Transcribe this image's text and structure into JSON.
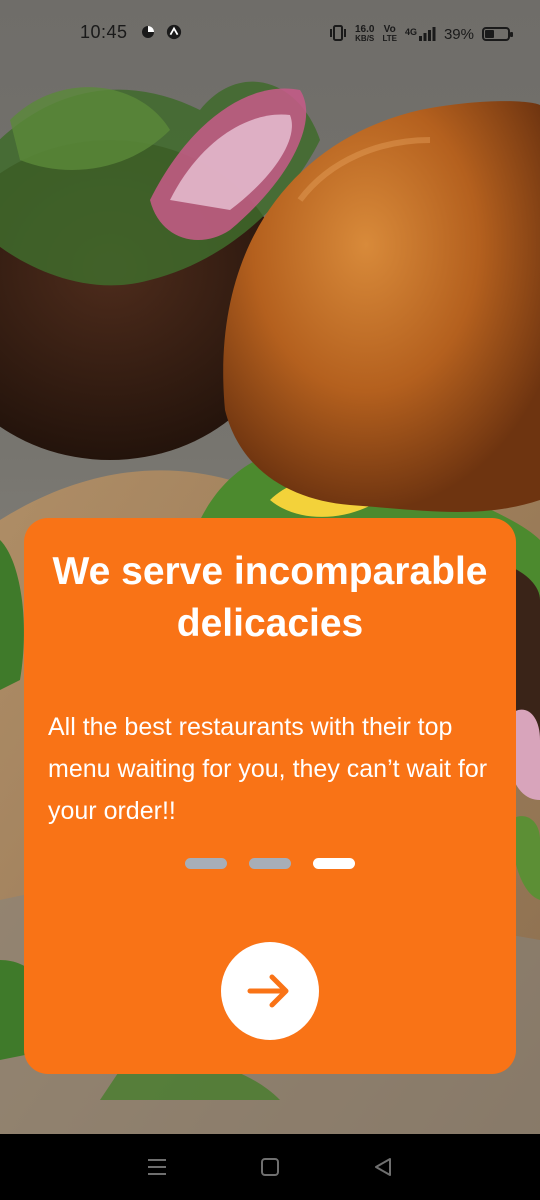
{
  "status_bar": {
    "time": "10:45",
    "network_speed": "16.0",
    "network_unit": "KB/S",
    "volte": "Vo",
    "lte": "LTE",
    "signal": "4G",
    "battery_percent": "39%",
    "battery_level": 0.39,
    "icons": [
      "app-icon",
      "arrow-badge-icon",
      "vibrate-icon",
      "signal-icon",
      "battery-icon"
    ]
  },
  "onboarding": {
    "title": "We serve incomparable delicacies",
    "description": "All the best restaurants with their top menu waiting for you, they can’t wait for your order!!",
    "pages": [
      {
        "active": false
      },
      {
        "active": false
      },
      {
        "active": true
      }
    ],
    "next_icon": "arrow-right-icon"
  },
  "nav_bar": {
    "icons": [
      "menu-icon",
      "home-icon",
      "back-icon"
    ]
  },
  "colors": {
    "accent": "#f97316",
    "dot_inactive": "#a7aeb8",
    "dot_active": "#ffffff"
  }
}
